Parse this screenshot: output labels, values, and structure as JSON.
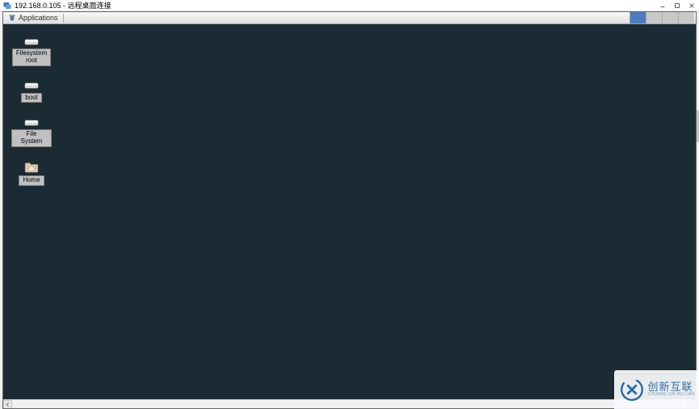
{
  "window": {
    "title": "192.168.0.105 - 远程桌面连接"
  },
  "panel": {
    "applications_label": "Applications"
  },
  "desktop": {
    "icons": [
      {
        "type": "disk",
        "label": "Filesystem\nroot"
      },
      {
        "type": "disk",
        "label": "boot"
      },
      {
        "type": "disk",
        "label": "File System"
      },
      {
        "type": "folder",
        "label": "Home"
      }
    ]
  },
  "watermark": {
    "cn": "创新互联",
    "en": "CHUANG XIN HU LIAN"
  },
  "colors": {
    "desktop_bg": "#1b2b34",
    "panel_accent": "#4a7dbf",
    "watermark_text": "#2b6ca3"
  }
}
